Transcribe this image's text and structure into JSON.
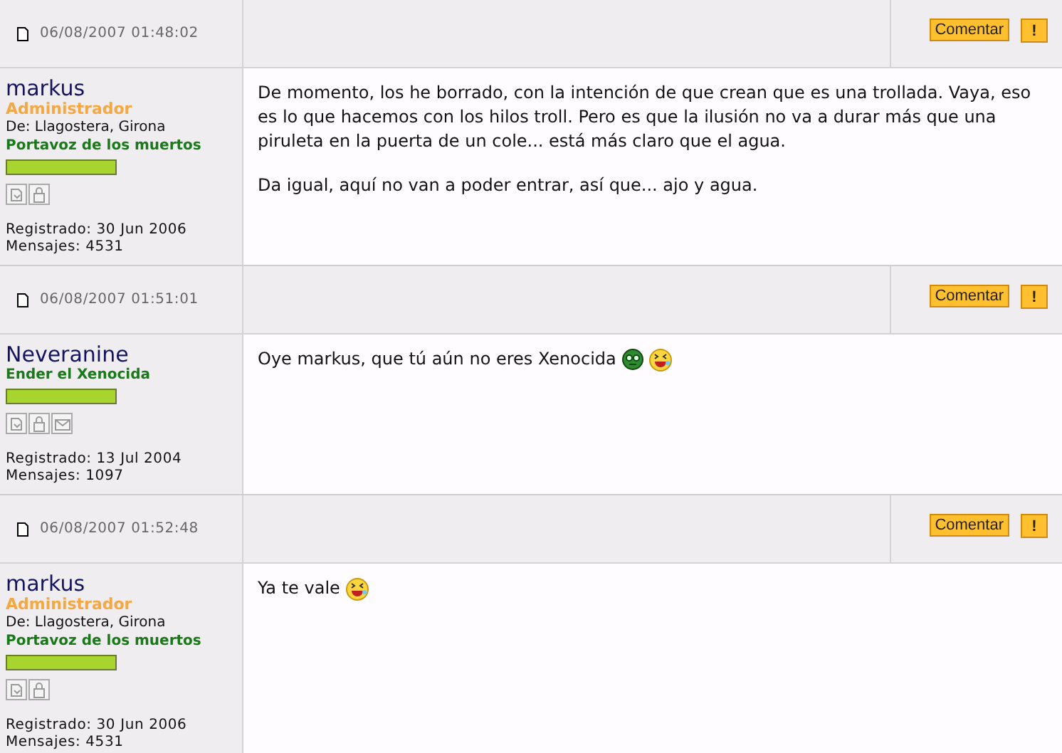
{
  "posts": [
    {
      "date": "06/08/2007 01:48:02",
      "buttons": {
        "comment": "Comentar",
        "report": "!"
      },
      "author": {
        "name": "markus",
        "role": "Administrador",
        "location": "De: Llagostera, Girona",
        "rank": "Portavoz de los muertos",
        "level": 1,
        "icons": [
          {
            "kind": "profile"
          },
          {
            "kind": "lock"
          }
        ],
        "registered": "Registrado: 30 Jun 2006",
        "messages": "Mensajes: 4531"
      },
      "paragraphs": [
        {
          "text": "De momento, los he borrado, con la intención de que crean que es una trollada. Vaya, eso es lo que hacemos con los hilos troll. Pero es que la ilusión no va a durar más que una piruleta en la puerta de un cole... está más claro que el agua."
        },
        {
          "text": "Da igual, aquí no van a poder entrar, así que... ajo y agua."
        }
      ]
    },
    {
      "date": "06/08/2007 01:51:01",
      "buttons": {
        "comment": "Comentar",
        "report": "!"
      },
      "author": {
        "name": "Neveranine",
        "rank": "Ender el Xenocida",
        "level": 1,
        "icons": [
          {
            "kind": "profile"
          },
          {
            "kind": "lock"
          },
          {
            "kind": "mail"
          }
        ],
        "registered": "Registrado: 13 Jul 2004",
        "messages": "Mensajes: 1097"
      },
      "paragraphs": [
        {
          "text": "Oye markus, que tú aún no eres Xenocida",
          "smileys": [
            {
              "kind": "goggle"
            },
            {
              "kind": "laughing"
            }
          ]
        }
      ]
    },
    {
      "date": "06/08/2007 01:52:48",
      "buttons": {
        "comment": "Comentar",
        "report": "!"
      },
      "author": {
        "name": "markus",
        "role": "Administrador",
        "location": "De: Llagostera, Girona",
        "rank": "Portavoz de los muertos",
        "level": 1,
        "icons": [
          {
            "kind": "profile"
          },
          {
            "kind": "lock"
          }
        ],
        "registered": "Registrado: 30 Jun 2006",
        "messages": "Mensajes: 4531"
      },
      "paragraphs": [
        {
          "text": "Ya te vale",
          "smileys": [
            {
              "kind": "laughing"
            }
          ]
        }
      ]
    }
  ]
}
